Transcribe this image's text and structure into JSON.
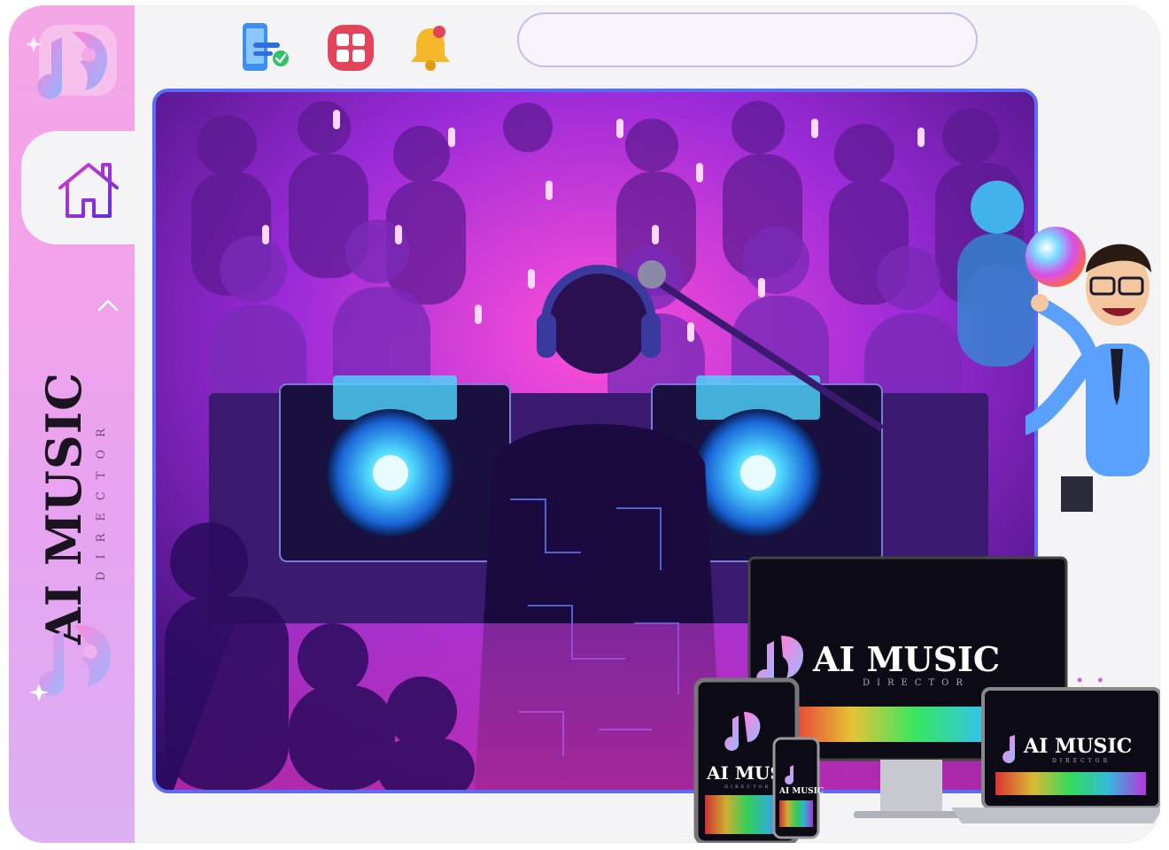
{
  "brand": {
    "name": "AI MUSIC",
    "tagline": "DIRECTOR"
  },
  "toolbar": {
    "icons": [
      "mobile-check-icon",
      "grid-apps-icon",
      "bell-notification-icon"
    ]
  },
  "search": {
    "value": "",
    "placeholder": ""
  },
  "devices": {
    "monitor_title": "AI MUSIC",
    "monitor_tagline": "DIRECTOR",
    "laptop_title": "AI MUSIC",
    "laptop_tagline": "DIRECTOR",
    "tablet_title": "AI MUS",
    "tablet_tagline": "DIRECTOR",
    "phone_title": "AI MUSIC"
  },
  "colors": {
    "sidebar_pink": "#f2a3ea",
    "accent_purple": "#7a3ad8",
    "hero_border": "#5a6cf4",
    "neon_magenta": "#ff3ad6",
    "neon_cyan": "#3ad8ff"
  }
}
